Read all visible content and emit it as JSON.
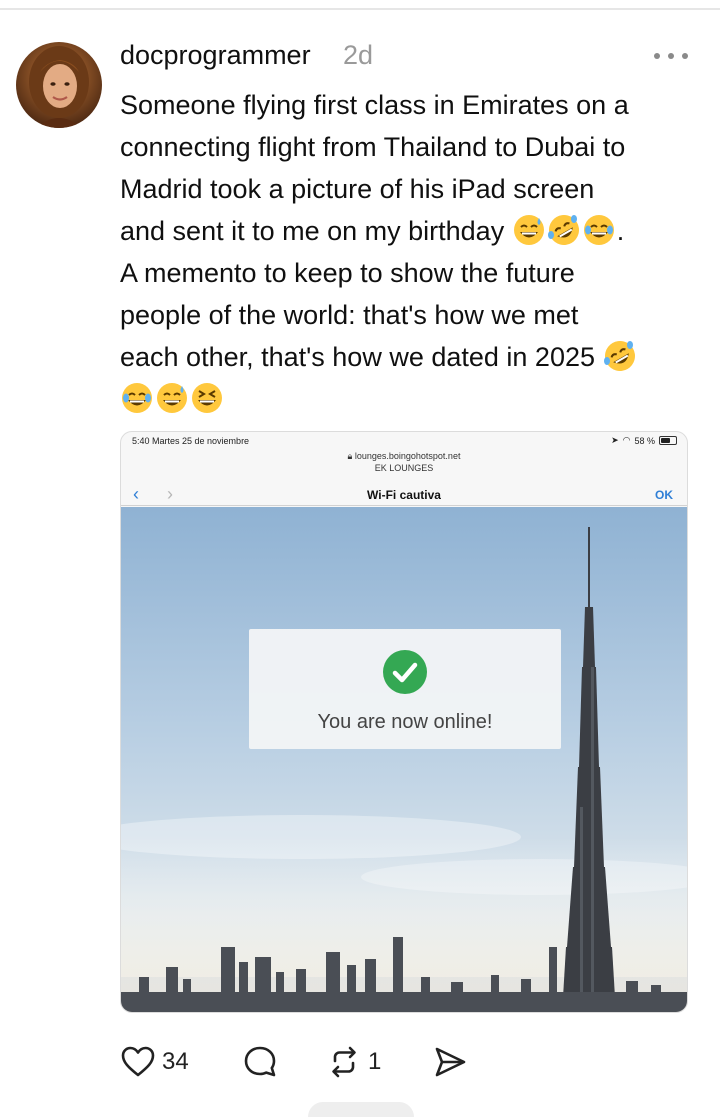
{
  "post": {
    "username": "docprogrammer",
    "timestamp": "2d",
    "text_lines": [
      "Someone flying first class in Emirates on a",
      "connecting flight from Thailand  to Dubai to",
      "Madrid took a picture  of his iPad screen",
      "and sent it to me on my birthday",
      "A memento to keep to show the future",
      "people of the world: that's how we met",
      "each other, that's how we dated in 2025"
    ],
    "line4_suffix": ".",
    "emoji_line4": [
      "sweat-smile",
      "rofl",
      "joy"
    ],
    "emoji_line7": [
      "rofl"
    ],
    "emoji_line8": [
      "joy",
      "sweat-smile",
      "laughing"
    ]
  },
  "screenshot": {
    "status_time": "5:40  Martes 25 de noviembre",
    "status_battery": "58 %",
    "url": "lounges.boingohotspot.net",
    "site_name": "EK LOUNGES",
    "nav_title": "Wi-Fi cautiva",
    "nav_ok": "OK",
    "back_glyph": "‹",
    "forward_glyph": "›",
    "message": "You are now online!"
  },
  "actions": {
    "likes": "34",
    "reposts": "1"
  },
  "icons": {
    "like": "heart-icon",
    "reply": "comment-icon",
    "repost": "repost-icon",
    "share": "send-icon",
    "more": "more-icon"
  },
  "colors": {
    "success_green": "#34a853",
    "link_blue": "#2f7fd6",
    "emoji_yellow": "#ffc83d"
  }
}
